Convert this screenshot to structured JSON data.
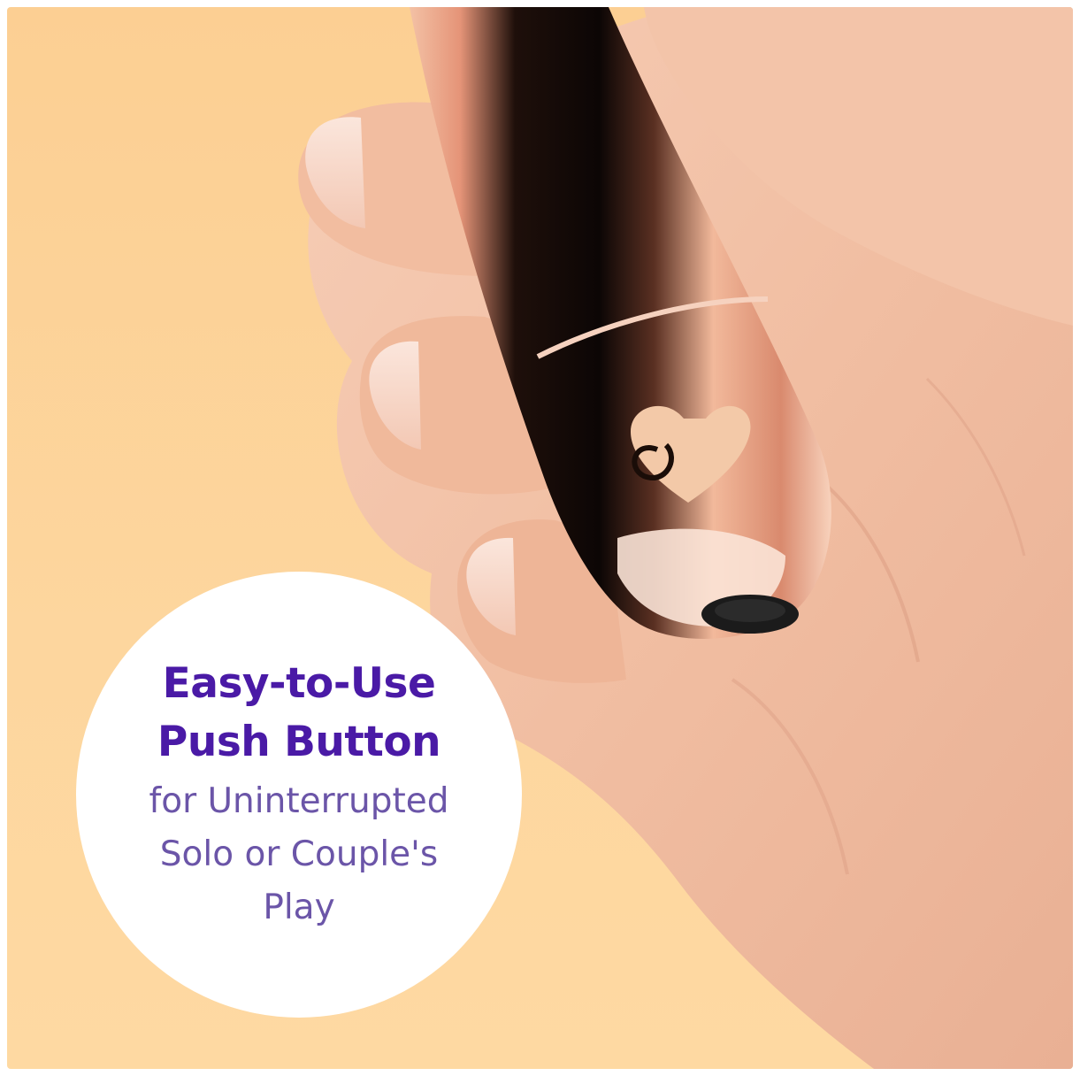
{
  "callout": {
    "headline_line1": "Easy-to-Use",
    "headline_line2": "Push Button",
    "sub_line1": "for Uninterrupted",
    "sub_line2": "Solo or Couple's",
    "sub_line3": "Play"
  },
  "colors": {
    "background": "#fdd49c",
    "headline": "#4a1aa6",
    "subtext": "#6b55a8",
    "callout_fill": "#ffffff",
    "device": "#e9a88a",
    "skin": "#f4c3a8"
  },
  "icons": {
    "logo": "heart-swirl-logo-icon",
    "button": "power-button-icon"
  }
}
